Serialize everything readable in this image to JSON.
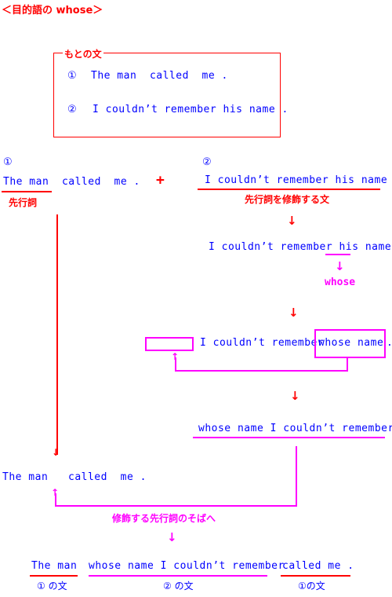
{
  "title": "＜目的語の whose＞",
  "original_box": {
    "label": "もとの文",
    "sentence1_num": "①",
    "sentence1": "The man  called  me .",
    "sentence2_num": "②",
    "sentence2": "I couldn’t remember his name ."
  },
  "step1": {
    "num1": "①",
    "sentence1": "The man  called  me .",
    "antecedent_label": "先行詞",
    "plus": "+",
    "num2": "②",
    "sentence2": "I couldn’t remember his name .",
    "modifier_label": "先行詞を修飾する文"
  },
  "step2": {
    "prefix": "I couldn’t remember ",
    "his": "his",
    "suffix": " name .",
    "replacement": "whose"
  },
  "step3": {
    "middle": "I couldn’t remember ",
    "boxed": "whose name",
    "period": "."
  },
  "step4": {
    "sentence": "whose name I couldn’t remember ."
  },
  "step5": {
    "left": "The man",
    "right": "called  me .",
    "move_label": "修飾する先行詞のそばへ"
  },
  "final": {
    "part1": "The man",
    "part2": "whose name I couldn’t remember",
    "part3": "called me .",
    "label1": "① の文",
    "label2": "② の文",
    "label3": "①の文"
  },
  "arrows": {
    "down": "↓",
    "up": "↑"
  },
  "colors": {
    "text": "#0000ff",
    "accent_red": "#ff0000",
    "accent_magenta": "#ff00ff"
  }
}
